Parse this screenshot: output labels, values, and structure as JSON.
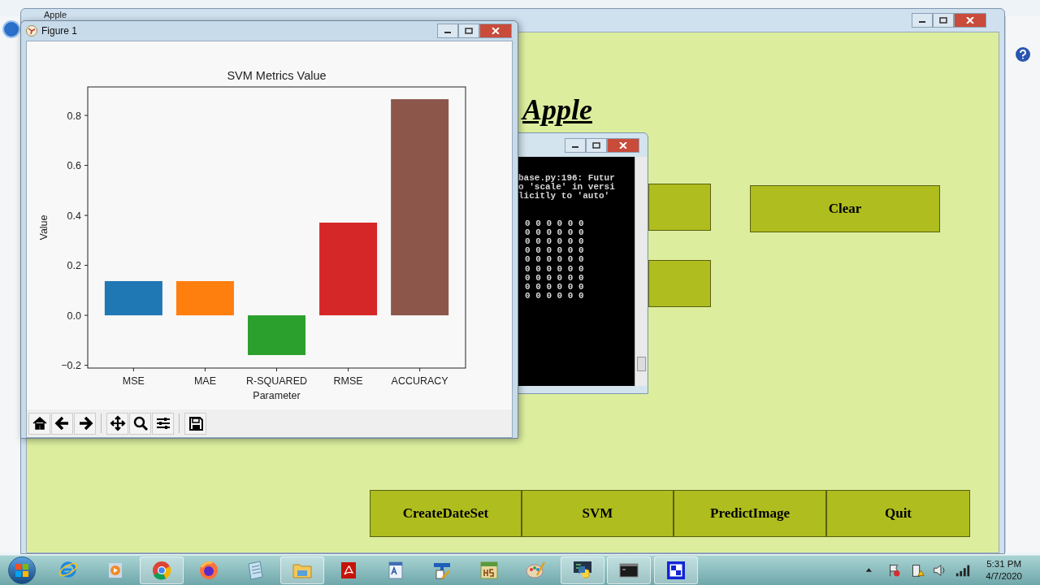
{
  "app_window": {
    "title": "Apple",
    "heading": "Apple",
    "top_buttons": [
      "Clear"
    ],
    "bottom_buttons": [
      "CreateDateSet",
      "SVM",
      "PredictImage",
      "Quit"
    ]
  },
  "console": {
    "message_lines": [
      "base.py:196: Futur",
      "o 'scale' in versi",
      "licitly to 'auto'"
    ],
    "grid_lines": [
      "0 0 0 0 0 0",
      "0 0 0 0 0 0",
      "0 0 0 0 0 0",
      "0 0 0 0 0 0",
      "0 0 0 0 0 0",
      "0 0 0 0 0 0",
      "0 0 0 0 0 0",
      "0 0 0 0 0 0",
      "0 0 0 0 0 0"
    ]
  },
  "figure": {
    "title": "Figure 1",
    "chart_data": {
      "type": "bar",
      "title": "SVM Metrics Value",
      "xlabel": "Parameter",
      "ylabel": "Value",
      "categories": [
        "MSE",
        "MAE",
        "R-SQUARED",
        "RMSE",
        "ACCURACY"
      ],
      "stacked": true,
      "series": [
        {
          "color": "#1f77b4",
          "values": [
            0.137,
            null,
            null,
            null,
            null
          ]
        },
        {
          "color": "#ff7f0e",
          "values": [
            null,
            0.137,
            null,
            null,
            null
          ]
        },
        {
          "color": "#2ca02c",
          "values": [
            null,
            null,
            -0.159,
            null,
            null
          ]
        },
        {
          "color": "#d62728",
          "values": [
            null,
            null,
            null,
            0.371,
            null
          ]
        },
        {
          "color": "#8c564b",
          "values": [
            null,
            null,
            null,
            null,
            0.865
          ]
        }
      ],
      "ylim": [
        -0.211,
        0.914
      ],
      "yticks": [
        {
          "value": -0.2,
          "label": "−0.2"
        },
        {
          "value": 0,
          "label": "0.0"
        },
        {
          "value": 0.2,
          "label": "0.2"
        },
        {
          "value": 0.4,
          "label": "0.4"
        },
        {
          "value": 0.6,
          "label": "0.6"
        },
        {
          "value": 0.8,
          "label": "0.8"
        }
      ]
    }
  },
  "taskbar": {
    "apps": [
      {
        "kind": "ie",
        "running": false
      },
      {
        "kind": "media",
        "running": false
      },
      {
        "kind": "chrome",
        "running": true
      },
      {
        "kind": "firefox",
        "running": false
      },
      {
        "kind": "notepad",
        "running": false
      },
      {
        "kind": "folder",
        "running": true
      },
      {
        "kind": "pdf",
        "running": false
      },
      {
        "kind": "wordpad",
        "running": false
      },
      {
        "kind": "editor",
        "running": false
      },
      {
        "kind": "hs",
        "running": false
      },
      {
        "kind": "paint",
        "running": false
      },
      {
        "kind": "python",
        "running": true
      },
      {
        "kind": "console",
        "running": true
      },
      {
        "kind": "app",
        "running": true
      }
    ],
    "clock": {
      "time": "5:31 PM",
      "date": "4/7/2020"
    }
  }
}
